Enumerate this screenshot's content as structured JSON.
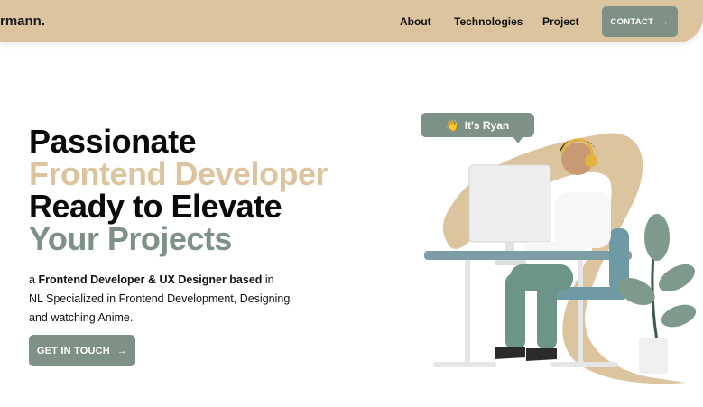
{
  "header": {
    "brand": "rmann.",
    "nav": [
      "About",
      "Technologies",
      "Project"
    ],
    "contact_label": "CONTACT",
    "contact_arrow": "→"
  },
  "hero": {
    "line1": "Passionate",
    "line2": "Frontend Developer",
    "line3": "Ready to Elevate",
    "line4": "Your Projects",
    "intro_prefix": "a ",
    "intro_bold": "Frontend Developer & UX Designer based",
    "intro_rest": " in NL Specialized in Frontend Development, Designing and watching Anime.",
    "cta_label": "GET IN TOUCH",
    "cta_arrow": "→"
  },
  "bubble": {
    "emoji": "👋",
    "text": "It's Ryan"
  },
  "colors": {
    "accent_tan": "#dcc49e",
    "accent_sage": "#7e9187"
  }
}
